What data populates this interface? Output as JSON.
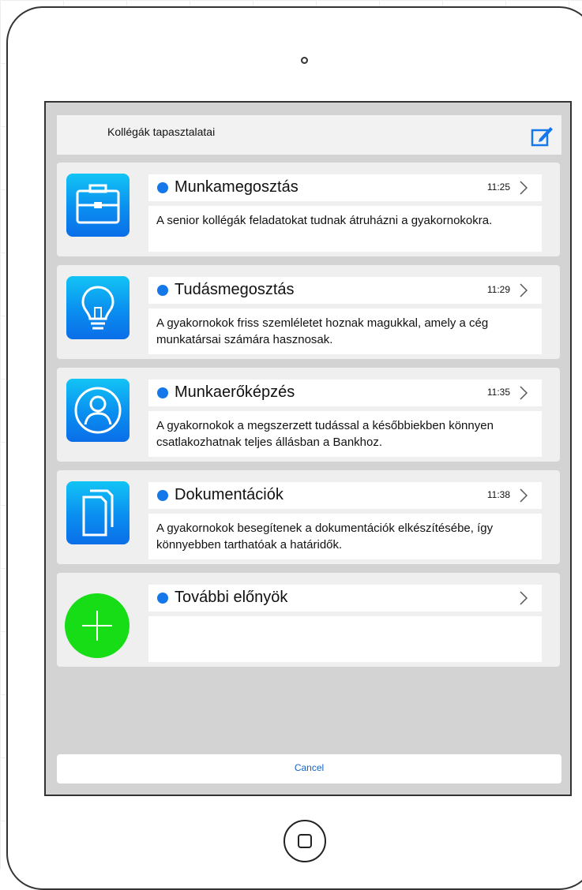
{
  "header": {
    "title": "Kollégák tapasztalatai",
    "compose_icon": "compose-icon"
  },
  "items": [
    {
      "title": "Munkamegosztás",
      "time": "11:25",
      "description": "A senior kollégák feladatokat tudnak átruházni a gyakornokokra.",
      "icon": "briefcase-icon"
    },
    {
      "title": "Tudásmegosztás",
      "time": "11:29",
      "description": "A gyakornokok friss szemléletet hoznak magukkal, amely a cég munkatársai számára hasznosak.",
      "icon": "lightbulb-icon"
    },
    {
      "title": "Munkaerőképzés",
      "time": "11:35",
      "description": "A gyakornokok a megszerzett tudással a későbbiekben könnyen csatlakozhatnak teljes állásban a Bankhoz.",
      "icon": "user-icon"
    },
    {
      "title": "Dokumentációk",
      "time": "11:38",
      "description": "A gyakornokok besegítenek a dokumentációk elkészítésébe, így könnyebben tarthatóak a határidők.",
      "icon": "documents-icon"
    },
    {
      "title": "További előnyök",
      "time": "",
      "description": "",
      "icon": "plus-icon"
    }
  ],
  "cancel": {
    "label": "Cancel"
  },
  "colors": {
    "accent_blue": "#1478ea",
    "icon_gradient_top": "#12c4f5",
    "icon_gradient_bottom": "#0a6ee8",
    "add_green": "#16dd16",
    "screen_bg": "#d3d3d3"
  }
}
